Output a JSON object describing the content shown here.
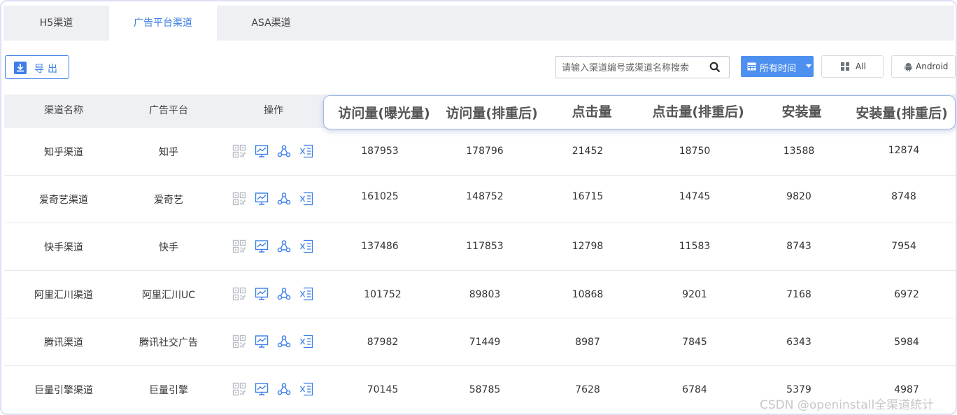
{
  "tabs": [
    {
      "label": "H5渠道"
    },
    {
      "label": "广告平台渠道"
    },
    {
      "label": "ASA渠道"
    }
  ],
  "toolbar": {
    "export_label": "导出",
    "search_placeholder": "请输入渠道编号或渠道名称搜索",
    "time_filter_label": "所有时间",
    "platform_all_label": "All",
    "platform_android_label": "Android"
  },
  "columns": {
    "channel_name": "渠道名称",
    "ad_platform": "广告平台",
    "actions": "操作",
    "visits_exposure": "访问量(曝光量)",
    "visits_dedup": "访问量(排重后)",
    "clicks": "点击量",
    "clicks_dedup": "点击量(排重后)",
    "installs": "安装量",
    "installs_dedup": "安装量(排重后)"
  },
  "rows": [
    {
      "name": "知乎渠道",
      "platform": "知乎",
      "visits": "187953",
      "visits_dedup": "178796",
      "clicks": "21452",
      "clicks_dedup": "18750",
      "installs": "13588",
      "installs_dedup": "12874"
    },
    {
      "name": "爱奇艺渠道",
      "platform": "爱奇艺",
      "visits": "161025",
      "visits_dedup": "148752",
      "clicks": "16715",
      "clicks_dedup": "14745",
      "installs": "9820",
      "installs_dedup": "8748"
    },
    {
      "name": "快手渠道",
      "platform": "快手",
      "visits": "137486",
      "visits_dedup": "117853",
      "clicks": "12798",
      "clicks_dedup": "11583",
      "installs": "8743",
      "installs_dedup": "7954"
    },
    {
      "name": "阿里汇川渠道",
      "platform": "阿里汇川UC",
      "visits": "101752",
      "visits_dedup": "89803",
      "clicks": "10868",
      "clicks_dedup": "9201",
      "installs": "7168",
      "installs_dedup": "6972"
    },
    {
      "name": "腾讯渠道",
      "platform": "腾讯社交广告",
      "visits": "87982",
      "visits_dedup": "71449",
      "clicks": "8987",
      "clicks_dedup": "7845",
      "installs": "6343",
      "installs_dedup": "5984"
    },
    {
      "name": "巨量引擎渠道",
      "platform": "巨量引擎",
      "visits": "70145",
      "visits_dedup": "58785",
      "clicks": "7628",
      "clicks_dedup": "6784",
      "installs": "5379",
      "installs_dedup": "4987"
    }
  ],
  "row_actions": [
    "qrcode-icon",
    "line-chart-icon",
    "share-icon",
    "excel-export-icon"
  ],
  "watermark": "CSDN @openinstall全渠道统计",
  "colors": {
    "accent": "#3d7fe6",
    "primary_button": "#4d90f0",
    "header_bg": "#eff0f4"
  }
}
